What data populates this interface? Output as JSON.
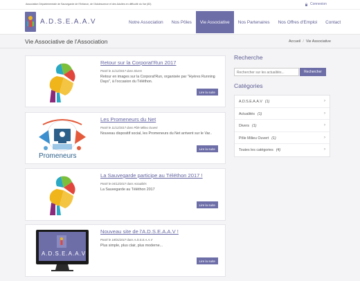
{
  "topbar": {
    "association": "Association Départementale de Sauvegarde de l'Enfance, de l'Adolescence et des Adultes en difficulté du Var (83)",
    "login_label": "Connexion"
  },
  "brand": {
    "name": "A.D.S.E.A.A.V"
  },
  "menu": [
    {
      "label": "Notre Association",
      "active": false
    },
    {
      "label": "Nos Pôles",
      "active": false
    },
    {
      "label": "Vie Associative",
      "active": true
    },
    {
      "label": "Nos Partenaires",
      "active": false
    },
    {
      "label": "Nos Offres d'Emploi",
      "active": false
    },
    {
      "label": "Contact",
      "active": false
    }
  ],
  "page": {
    "title": "Vie Associative de l'Association",
    "breadcrumb": [
      "Accueil",
      "Vie Associative"
    ]
  },
  "articles": [
    {
      "title": "Retour sur la Corporat'Run 2017",
      "meta": "Posté le 11/12/2017 dans Divers",
      "excerpt": "Retour en images sur la Corporat'Run, organisée par \"Hyères Running Days\", à l'occasion du Téléthon.",
      "read_more": "Lire la suite",
      "thumb_icon": "colorful-logo-icon"
    },
    {
      "title": "Les Promeneurs du Net",
      "meta": "Posté le 11/12/2017 dans Pôle Milieu Ouvert",
      "excerpt": "Nouveau dispositif social, les Promeneurs du Net arrivent sur le Var..",
      "read_more": "Lire la suite",
      "thumb_icon": "promeneurs-illustration-icon",
      "thumb_text": "Promeneurs"
    },
    {
      "title": "La Sauvegarde participe au Téléthon 2017 !",
      "meta": "Posté le 04/12/2017 dans Actualités",
      "excerpt": "La Sauvegarde au Téléthon 2017",
      "read_more": "Lire la suite",
      "thumb_icon": "colorful-logo-icon"
    },
    {
      "title": "Nouveau site de l'A.D.S.E.A.A.V !",
      "meta": "Posté le 18/01/2017 dans A.D.S.E.A.A.V",
      "excerpt": "Plus simple, plus clair, plus moderne...",
      "read_more": "Lire la suite",
      "thumb_icon": "monitor-icon",
      "thumb_text": "A.D.S.E.A.A.V"
    }
  ],
  "sidebar": {
    "search_heading": "Recherche",
    "search_placeholder": "Rechercher sur les actualités...",
    "search_button": "Rechercher",
    "categories_heading": "Catégories",
    "categories": [
      {
        "name": "A.D.S.E.A.A.V",
        "count": "(1)"
      },
      {
        "name": "Actualités",
        "count": "(1)"
      },
      {
        "name": "Divers",
        "count": "(1)"
      },
      {
        "name": "Pôle Milieu Ouvert",
        "count": "(1)"
      },
      {
        "name": "Toutes les catégories",
        "count": "(4)"
      }
    ]
  },
  "colors": {
    "accent": "#6d6da8",
    "link": "#6565a3",
    "background": "#f4f4f6"
  }
}
